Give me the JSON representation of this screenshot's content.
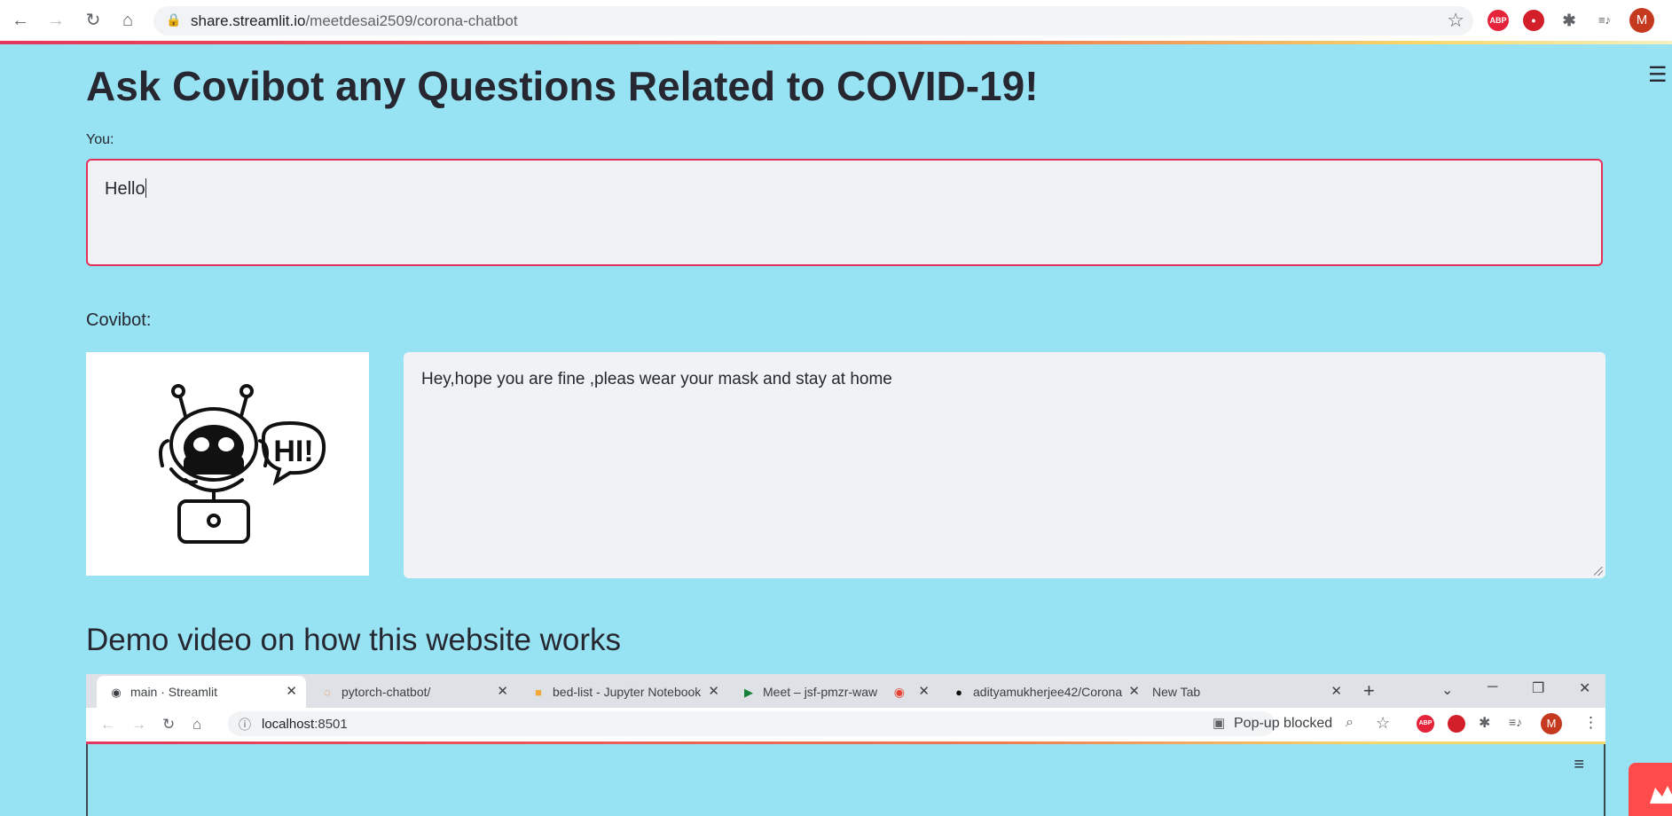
{
  "browser": {
    "url_host": "share.streamlit.io",
    "url_path": "/meetdesai2509/corona-chatbot",
    "nav": {
      "back_icon": "←",
      "forward_icon": "→",
      "reload_icon": "↻",
      "home_icon": "⌂"
    },
    "extensions": [
      {
        "name": "adblock-plus",
        "label": "ABP",
        "color": "#e5243b"
      },
      {
        "name": "ublock",
        "label": "●",
        "color": "#d21f2a"
      },
      {
        "name": "puzzle",
        "label": "✱",
        "color": "#5f6368"
      },
      {
        "name": "media",
        "label": "≡♪",
        "color": "#5f6368"
      },
      {
        "name": "profile",
        "label": "M",
        "color": "#c5391f"
      }
    ]
  },
  "page": {
    "title": "Ask Covibot any Questions Related to COVID-19!",
    "you_label": "You:",
    "user_input_value": "Hello",
    "bot_label": "Covibot:",
    "bot_image_text": "HI!",
    "bot_reply": "Hey,hope you are fine ,pleas wear your mask and stay at home",
    "demo_heading": "Demo video on how this website works",
    "menu_icon": "☰"
  },
  "demo": {
    "tabs": [
      {
        "label": "main · Streamlit",
        "icon": "◉"
      },
      {
        "label": "pytorch-chatbot/",
        "icon": "◌"
      },
      {
        "label": "bed-list - Jupyter Notebook",
        "icon": "■"
      },
      {
        "label": "Meet – jsf-pmzr-waw",
        "icon": "▶"
      },
      {
        "label": "adityamukherjee42/Corona",
        "icon": "●"
      },
      {
        "label": "New Tab",
        "icon": ""
      }
    ],
    "new_tab_icon": "+",
    "url_host": "localhost",
    "url_port": ":8501",
    "popup_blocked": "Pop-up blocked",
    "menu_icon": "≡",
    "window_controls": {
      "minimize": "─",
      "restore": "❐",
      "close": "✕"
    }
  },
  "colors": {
    "background": "#98e3f3",
    "input_border": "#e2325c",
    "text": "#262730"
  }
}
